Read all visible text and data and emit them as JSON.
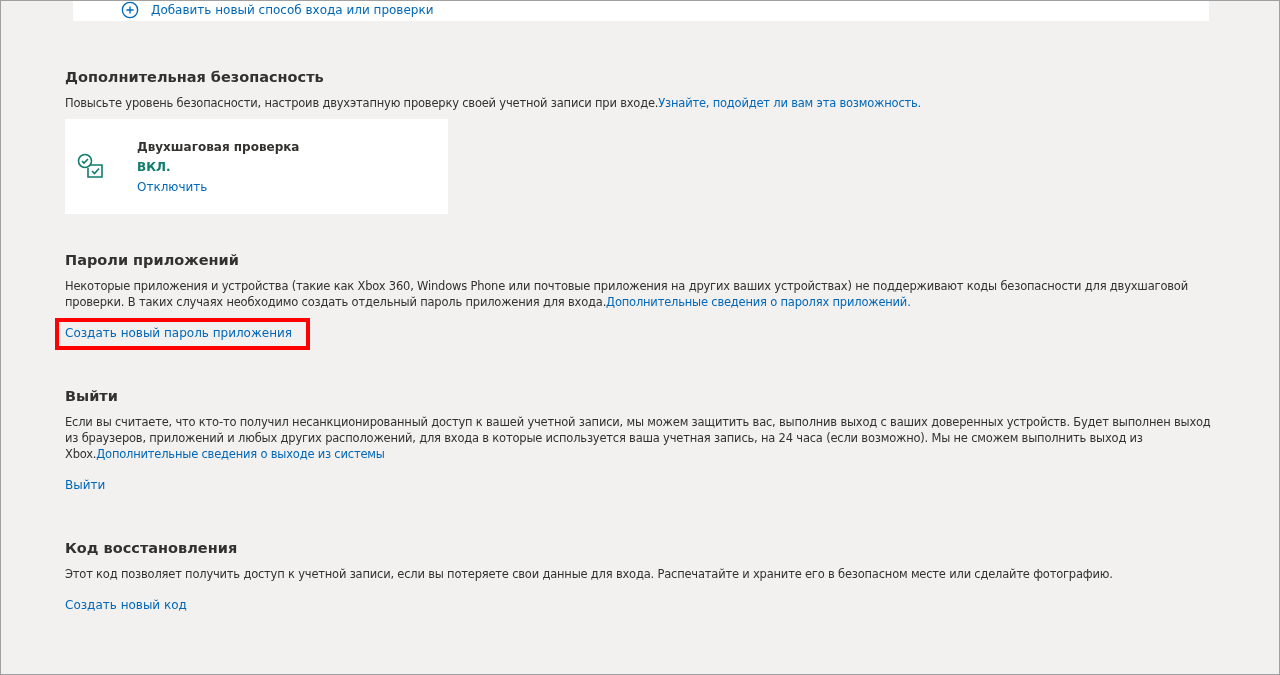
{
  "top_card": {
    "link": "Добавить новый способ входа или проверки"
  },
  "sections": [
    {
      "title": "Дополнительная безопасность",
      "text": "Повысьте уровень безопасности, настроив двухэтапную проверку своей учетной записи при входе.",
      "text_link": "Узнайте, подойдет ли вам эта возможность.",
      "card": {
        "title": "Двухшаговая проверка",
        "status": "ВКЛ.",
        "on": true,
        "action": "Отключить"
      }
    },
    {
      "title": "Пароли приложений",
      "text": "Некоторые приложения и устройства (такие как Xbox 360, Windows Phone или почтовые приложения на других ваших устройствах) не поддерживают коды безопасности для двухшаговой проверки. В таких случаях необходимо создать отдельный пароль приложения для входа.",
      "text_link": "Дополнительные сведения о паролях приложений.",
      "action": "Создать новый пароль приложения",
      "highlighted": true
    },
    {
      "title": "Выйти",
      "text": "Если вы считаете, что кто-то получил несанкционированный доступ к вашей учетной записи, мы можем защитить вас, выполнив выход с ваших доверенных устройств. Будет выполнен выход из браузеров, приложений и любых других расположений, для входа в которые используется ваша учетная запись, на 24 часа (если возможно). Мы не сможем выполнить выход из Xbox.",
      "text_link": "Дополнительные сведения о выходе из системы",
      "action": "Выйти",
      "highlighted": false
    },
    {
      "title": "Код восстановления",
      "text": "Этот код позволяет получить доступ к учетной записи, если вы потеряете свои данные для входа. Распечатайте и храните его в безопасном месте или сделайте фотографию.",
      "action": "Создать новый код",
      "highlighted": false
    }
  ]
}
